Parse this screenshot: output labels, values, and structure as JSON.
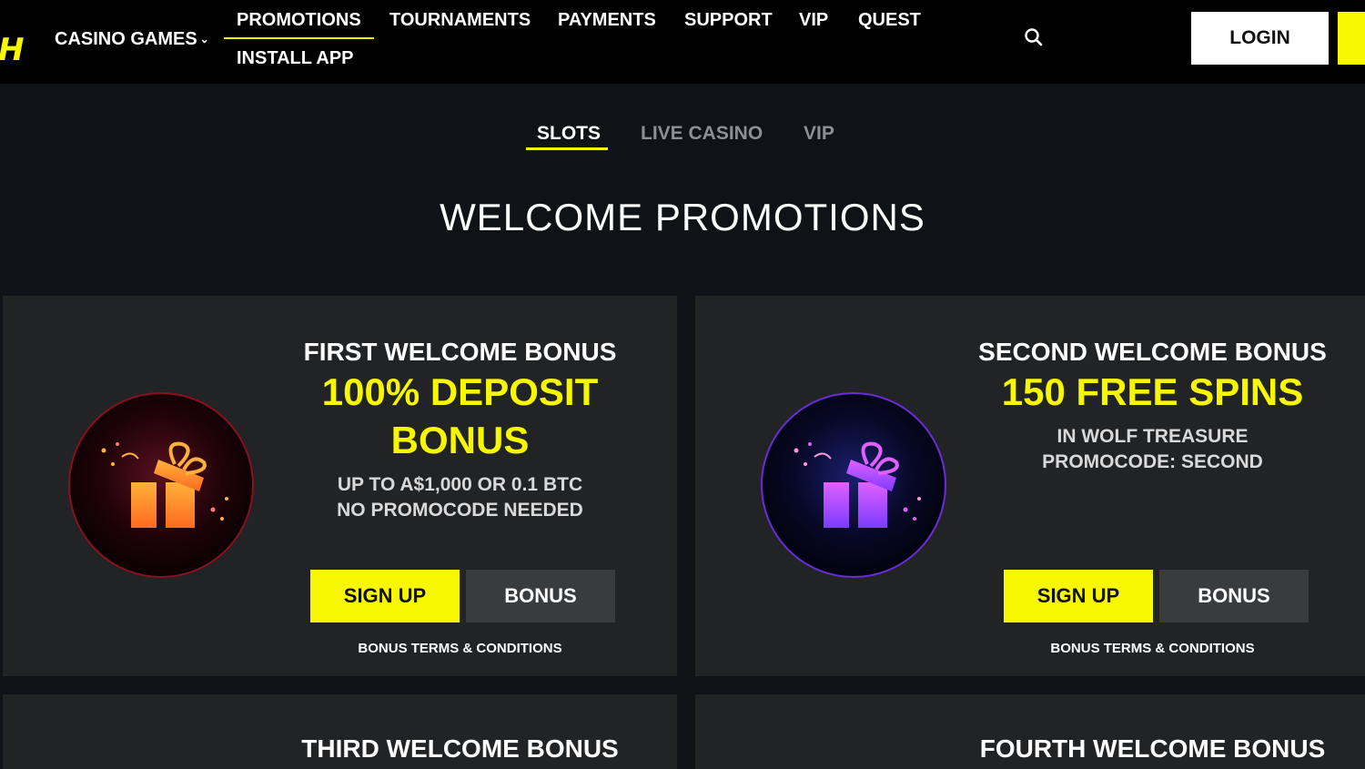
{
  "header": {
    "logo_text": "H",
    "nav": {
      "casino_games": "CASINO GAMES",
      "promotions": "PROMOTIONS",
      "tournaments": "TOURNAMENTS",
      "payments": "PAYMENTS",
      "support": "SUPPORT",
      "vip": "VIP",
      "quest": "QUEST",
      "install_app": "INSTALL APP"
    },
    "chevron_icon": "chevron-down-icon",
    "search_icon": "search-icon",
    "login_label": "LOGIN"
  },
  "tabs": {
    "slots": "SLOTS",
    "live_casino": "LIVE CASINO",
    "vip": "VIP",
    "active": "SLOTS"
  },
  "page_title": "WELCOME PROMOTIONS",
  "cards": [
    {
      "title": "FIRST WELCOME BONUS",
      "highlight": "100% DEPOSIT BONUS",
      "sub_line1": "UP TO A$1,000 OR 0.1 BTC",
      "sub_line2": "NO PROMOCODE NEEDED",
      "signup_label": "SIGN UP",
      "bonus_label": "BONUS",
      "terms_label": "BONUS TERMS & CONDITIONS",
      "icon": "gift-icon",
      "color": "#f5a623"
    },
    {
      "title": "SECOND WELCOME BONUS",
      "highlight": "150 FREE SPINS",
      "sub_line1": "IN WOLF TREASURE",
      "sub_line2": "PROMOCODE: SECOND",
      "signup_label": "SIGN UP",
      "bonus_label": "BONUS",
      "terms_label": "BONUS TERMS & CONDITIONS",
      "icon": "gift-icon",
      "color": "#b44cf0"
    },
    {
      "title": "THIRD WELCOME BONUS"
    },
    {
      "title": "FOURTH WELCOME BONUS"
    }
  ],
  "colors": {
    "accent": "#f7f700",
    "background": "#0f1216",
    "card": "#222325",
    "header": "#000000"
  }
}
